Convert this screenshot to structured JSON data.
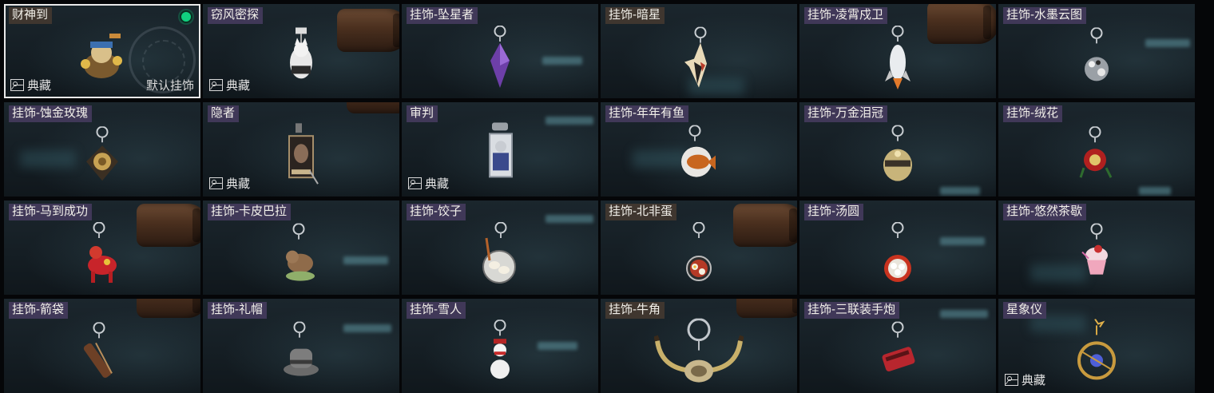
{
  "badge_label": "典藏",
  "default_label": "默认挂饰",
  "items": [
    {
      "title": "财神到",
      "collection": true,
      "default": true,
      "equipped": true,
      "selected": true,
      "icon": "caishen-figure-icon"
    },
    {
      "title": "窃风密探",
      "collection": true,
      "icon": "spy-cat-charm-icon"
    },
    {
      "title": "挂饰-坠星者",
      "icon": "purple-crystal-charm-icon"
    },
    {
      "title": "挂饰-暗星",
      "icon": "dark-star-charm-icon"
    },
    {
      "title": "挂饰-凌霄戍卫",
      "icon": "rocket-charm-icon"
    },
    {
      "title": "挂饰-水墨云图",
      "icon": "ink-sphere-charm-icon"
    },
    {
      "title": "挂饰-蚀金玫瑰",
      "icon": "gold-rose-charm-icon"
    },
    {
      "title": "隐者",
      "collection": true,
      "icon": "hermit-card-charm-icon"
    },
    {
      "title": "审判",
      "collection": true,
      "icon": "judgement-card-charm-icon"
    },
    {
      "title": "挂饰-年年有鱼",
      "icon": "fish-plate-charm-icon"
    },
    {
      "title": "挂饰-万金泪冠",
      "icon": "gold-crown-charm-icon"
    },
    {
      "title": "挂饰-绒花",
      "icon": "velvet-flower-charm-icon"
    },
    {
      "title": "挂饰-马到成功",
      "icon": "red-horse-charm-icon"
    },
    {
      "title": "挂饰-卡皮巴拉",
      "icon": "capybara-charm-icon"
    },
    {
      "title": "挂饰-饺子",
      "icon": "dumpling-plate-charm-icon"
    },
    {
      "title": "挂饰-北非蛋",
      "icon": "shakshuka-pan-charm-icon"
    },
    {
      "title": "挂饰-汤圆",
      "icon": "tangyuan-bowl-charm-icon"
    },
    {
      "title": "挂饰-悠然茶歇",
      "icon": "cupcake-charm-icon"
    },
    {
      "title": "挂饰-箭袋",
      "icon": "quiver-charm-icon"
    },
    {
      "title": "挂饰-礼帽",
      "icon": "top-hat-charm-icon"
    },
    {
      "title": "挂饰-雪人",
      "icon": "snowman-charm-icon"
    },
    {
      "title": "挂饰-牛角",
      "icon": "bull-horns-charm-icon"
    },
    {
      "title": "挂饰-三联装手炮",
      "icon": "triple-cannon-charm-icon"
    },
    {
      "title": "星象仪",
      "collection": true,
      "icon": "astrolabe-charm-icon"
    }
  ],
  "colors": {
    "card_bg": "#151e24",
    "title_bg": "#463a30",
    "title_bg_violet": "#483c60",
    "equipped_dot": "#11d07f",
    "selected_border": "#e9e9e9"
  }
}
